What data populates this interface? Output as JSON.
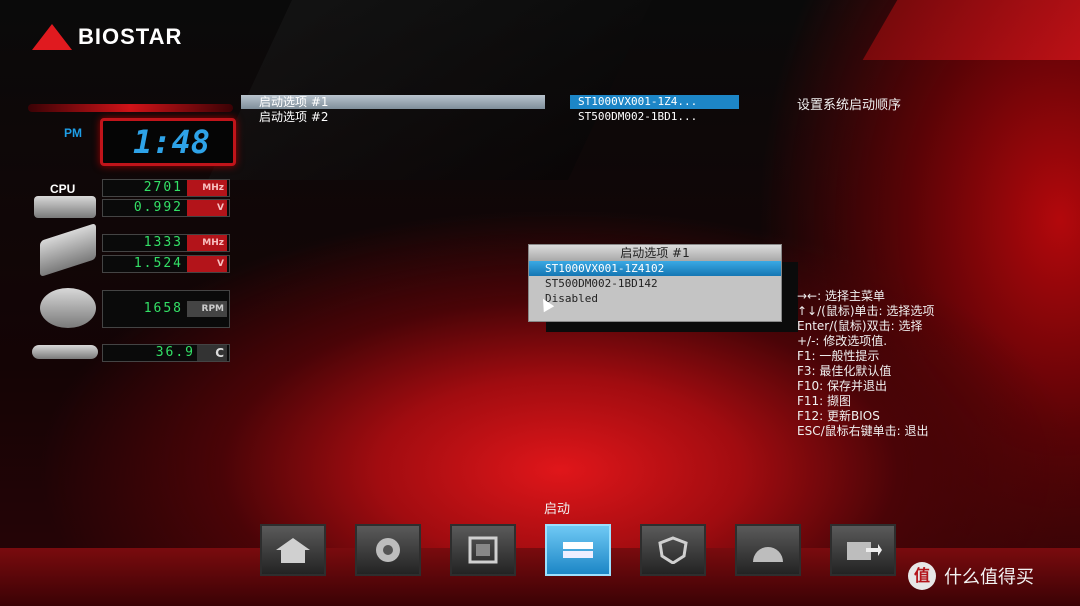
{
  "brand": {
    "name": "BIOSTAR"
  },
  "monitor": {
    "clock_period": "PM",
    "clock_time": "1:48",
    "cpu_label": "CPU",
    "cpu_freq": "2701",
    "cpu_freq_unit": "MHz",
    "cpu_volt": "0.992",
    "cpu_volt_unit": "V",
    "mem_freq": "1333",
    "mem_freq_unit": "MHz",
    "mem_volt": "1.524",
    "mem_volt_unit": "V",
    "fan_rpm": "1658",
    "fan_unit": "RPM",
    "temp": "36.9",
    "temp_unit": "C"
  },
  "menu": {
    "items": [
      {
        "label": "启动选项 #1",
        "value": "ST1000VX001-1Z4...",
        "selected": true
      },
      {
        "label": "启动选项 #2",
        "value": "ST500DM002-1BD1...",
        "selected": false
      }
    ]
  },
  "help_title": "设置系统启动顺序",
  "popup": {
    "title": "启动选项 #1",
    "options": [
      {
        "label": "ST1000VX001-1Z4102",
        "selected": true
      },
      {
        "label": "ST500DM002-1BD142",
        "selected": false
      },
      {
        "label": "Disabled",
        "selected": false
      }
    ]
  },
  "help_keys": [
    "→←: 选择主菜单",
    "↑↓/(鼠标)单击: 选择选项",
    "Enter/(鼠标)双击: 选择",
    "+/-: 修改选项值.",
    "F1: 一般性提示",
    "F3: 最佳化默认值",
    "F10: 保存并退出",
    "F11: 撷图",
    "F12: 更新BIOS",
    "ESC/鼠标右键单击: 退出"
  ],
  "nav": {
    "active_label": "启动",
    "tabs": [
      {
        "icon": "home-icon",
        "active": false
      },
      {
        "icon": "overclock-icon",
        "active": false
      },
      {
        "icon": "chipset-icon",
        "active": false
      },
      {
        "icon": "boot-drive-icon",
        "active": true
      },
      {
        "icon": "security-shield-icon",
        "active": false
      },
      {
        "icon": "speedometer-icon",
        "active": false
      },
      {
        "icon": "exit-folder-icon",
        "active": false
      }
    ]
  },
  "watermark": {
    "symbol": "值",
    "text": "什么值得买"
  }
}
